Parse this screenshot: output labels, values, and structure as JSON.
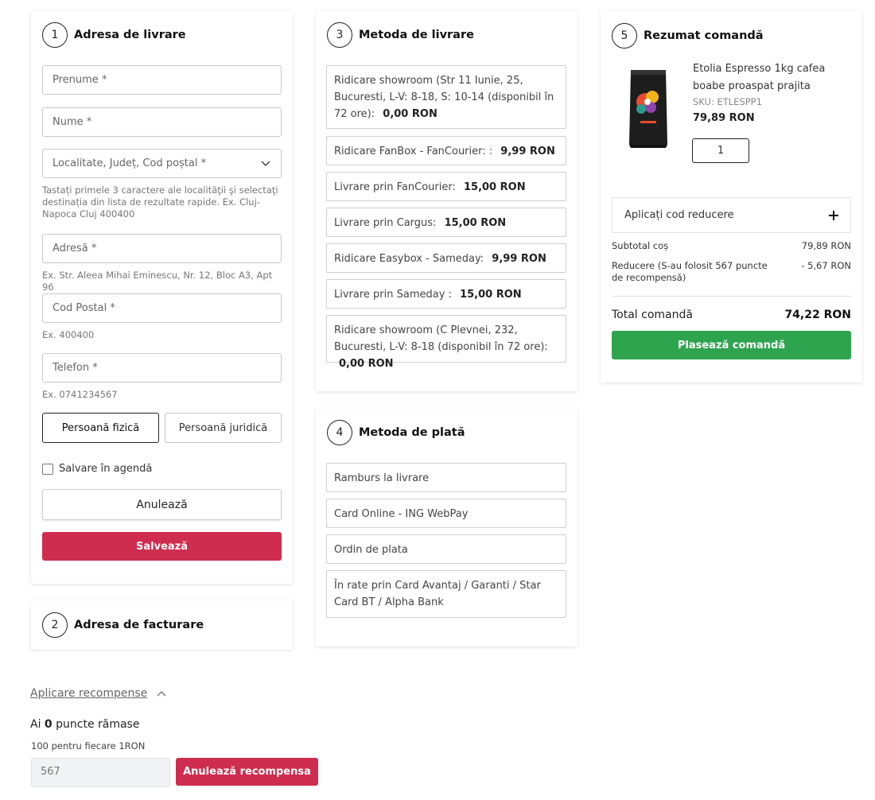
{
  "delivery_address": {
    "step": "1",
    "title": "Adresa de livrare",
    "first_name_placeholder": "Prenume *",
    "last_name_placeholder": "Nume *",
    "locality_placeholder": "Localitate, Județ, Cod poștal *",
    "locality_hint": "Tastați primele 3 caractere ale localităţii şi selectaţi destinația din lista de rezultate rapide. Ex. Cluj-Napoca Cluj 400400",
    "address_placeholder": "Adresă *",
    "address_hint": "Ex. Str. Aleea Mihai Eminescu, Nr. 12, Bloc A3, Apt 96",
    "postal_placeholder": "Cod Postal *",
    "postal_hint": "Ex. 400400",
    "phone_placeholder": "Telefon *",
    "phone_hint": "Ex. 0741234567",
    "person_individual": "Persoană fizică",
    "person_legal": "Persoană juridică",
    "save_agenda": "Salvare în agendă",
    "cancel": "Anulează",
    "save": "Salvează"
  },
  "billing_address": {
    "step": "2",
    "title": "Adresa de facturare"
  },
  "shipping": {
    "step": "3",
    "title": "Metoda de livrare",
    "options": [
      {
        "label": "Ridicare showroom (Str 11 Iunie, 25, Bucuresti, L-V: 8-18, S: 10-14 (disponibil în 72 ore):",
        "price": "0,00 RON"
      },
      {
        "label": "Ridicare FanBox - FanCourier: :",
        "price": "9,99 RON"
      },
      {
        "label": "Livrare prin FanCourier:",
        "price": "15,00 RON"
      },
      {
        "label": "Livrare prin Cargus:",
        "price": "15,00 RON"
      },
      {
        "label": "Ridicare Easybox - Sameday:",
        "price": "9,99 RON"
      },
      {
        "label": "Livrare prin Sameday :",
        "price": "15,00 RON"
      },
      {
        "label": "Ridicare showroom (C Plevnei, 232, Bucuresti, L-V: 8-18 (disponibil în 72 ore):",
        "price": "0,00 RON"
      }
    ]
  },
  "payment": {
    "step": "4",
    "title": "Metoda de plată",
    "options": [
      "Ramburs la livrare",
      "Card Online - ING WebPay",
      "Ordin de plata",
      "În rate prin Card Avantaj / Garanti / Star Card BT / Alpha Bank"
    ]
  },
  "summary": {
    "step": "5",
    "title": "Rezumat comandă",
    "product_name": "Etolia Espresso 1kg cafea boabe proaspat prajita",
    "sku": "SKU: ETLESPP1",
    "product_price": "79,89 RON",
    "quantity": "1",
    "discount_label": "Aplicați cod reducere",
    "subtotal_label": "Subtotal coș",
    "subtotal_value": "79,89 RON",
    "reduction_label": "Reducere (S-au folosit 567 puncte de recompensă)",
    "reduction_value": "- 5,67 RON",
    "total_label": "Total comandă",
    "total_value": "74,22 RON",
    "place_order": "Plasează comandă"
  },
  "rewards": {
    "toggle_label": "Aplicare recompense",
    "remaining_prefix": "Ai",
    "remaining_points": "0",
    "remaining_suffix": "puncte rămase",
    "rate": "100 pentru fiecare 1RON",
    "points_value": "567",
    "cancel_rewards": "Anulează recompensa"
  },
  "colors": {
    "primary_red": "#cf2d4f",
    "success_green": "#2ea44f"
  }
}
